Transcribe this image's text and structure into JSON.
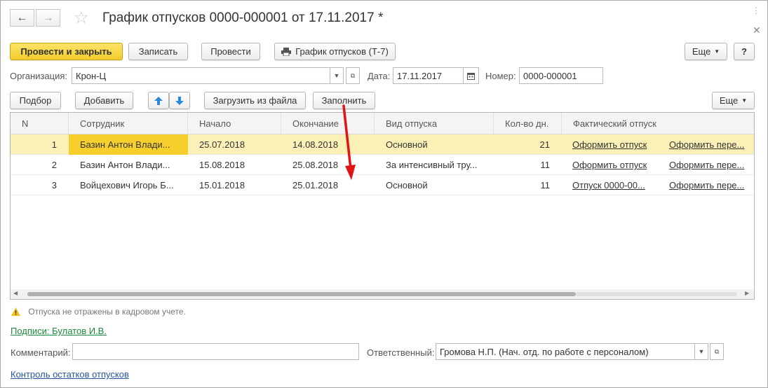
{
  "window": {
    "title": "График отпусков 0000-000001 от 17.11.2017 *",
    "back_icon": "arrow-left-icon",
    "forward_icon": "arrow-right-icon",
    "favorite_icon": "star-icon",
    "menu_icon": "more-vertical-icon",
    "close_icon": "close-icon"
  },
  "toolbar": {
    "post_close": "Провести и закрыть",
    "save": "Записать",
    "post": "Провести",
    "print_t7": "График отпусков (Т-7)",
    "more": "Еще",
    "help": "?"
  },
  "form": {
    "org_label": "Организация:",
    "org_value": "Крон-Ц",
    "date_label": "Дата:",
    "date_value": "17.11.2017",
    "number_label": "Номер:",
    "number_value": "0000-000001"
  },
  "table_toolbar": {
    "pick": "Подбор",
    "add": "Добавить",
    "load": "Загрузить из файла",
    "fill": "Заполнить",
    "more": "Еще"
  },
  "table": {
    "headers": [
      "N",
      "Сотрудник",
      "Начало",
      "Окончание",
      "Вид отпуска",
      "Кол-во дн.",
      "Фактический отпуск"
    ],
    "rows": [
      {
        "n": "1",
        "employee": "Базин Антон Влади...",
        "start": "25.07.2018",
        "end": "14.08.2018",
        "kind": "Основной",
        "days": "21",
        "fact": "Оформить отпуск",
        "transfer": "Оформить пере..."
      },
      {
        "n": "2",
        "employee": "Базин Антон Влади...",
        "start": "15.08.2018",
        "end": "25.08.2018",
        "kind": "За интенсивный тру...",
        "days": "11",
        "fact": "Оформить отпуск",
        "transfer": "Оформить пере..."
      },
      {
        "n": "3",
        "employee": "Войцехович Игорь Б...",
        "start": "15.01.2018",
        "end": "25.01.2018",
        "kind": "Основной",
        "days": "11",
        "fact": "Отпуск 0000-00...",
        "transfer": "Оформить пере..."
      }
    ]
  },
  "footer": {
    "warning": "Отпуска не отражены в кадровом учете.",
    "signatures": "Подписи: Булатов И.В.",
    "comment_label": "Комментарий:",
    "comment_value": "",
    "responsible_label": "Ответственный:",
    "responsible_value": "Громова Н.П. (Нач. отд. по работе с персоналом)",
    "control_link": "Контроль остатков отпусков"
  },
  "colors": {
    "primary_button": "#f2cc2c",
    "selected_row": "#fbf0b6",
    "focused_cell": "#f6cf2c",
    "link_green": "#1a8a3b",
    "link_blue": "#24579d",
    "annotation_arrow": "#e01414"
  }
}
